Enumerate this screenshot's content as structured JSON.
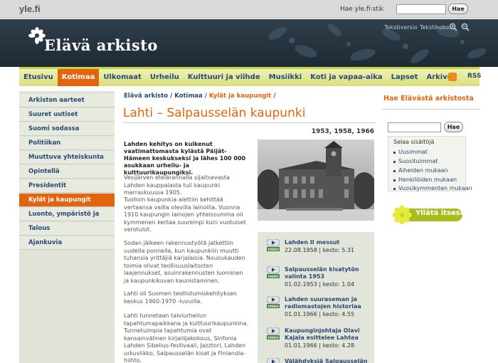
{
  "topbar": {
    "logo": "yle.fi",
    "search_label": "Hae yle.fi:stä:",
    "search_value": "",
    "search_button": "Hae"
  },
  "banner": {
    "site_title": "Elävä arkisto",
    "text_version": "Tekstiversio",
    "text_size": "Tekstikoko:"
  },
  "nav": {
    "items": [
      "Etusivu",
      "Kotimaa",
      "Ulkomaat",
      "Urheilu",
      "Kulttuuri ja viihde",
      "Musiikki",
      "Koti ja vapaa-aika",
      "Lapset",
      "Arkivet"
    ],
    "active": "Kotimaa",
    "rss": "RSS"
  },
  "sidebar": {
    "items": [
      "Arkiston aarteet",
      "Suuret uutiset",
      "Suomi sodassa",
      "Politiikan vuosikymmenet",
      "Muuttuva yhteiskunta",
      "Opintellä",
      "Presidentit",
      "Kylät ja kaupungit",
      "Luonto, ympäristö ja eläimet",
      "Talous",
      "Ajankuvia"
    ],
    "active": "Kylät ja kaupungit"
  },
  "breadcrumb": {
    "parts": [
      "Elävä arkisto",
      "Kotimaa"
    ],
    "current": "Kylät ja kaupungit"
  },
  "article": {
    "title": "Lahti – Salpausselän kaupunki",
    "years": "1953, 1958, 1966",
    "lead": "Lahden kehitys on kulkenut vaatimattomasta kylästä Päijät-Hämeen keskukseksi ja lähes 100 000 asukkaan urheilu- ja kulttuurikaupungiksi.",
    "paragraphs": [
      "Vesijärven etelärannalla sijaitsevasta Lahden kauppalasta tuli kaupunki marraskuussa 1905.",
      "Tuolloin kaupunkia alettiin kehittää vertaansa vailla olevilla lainoilla. Vuonna 1910 kaupungin lainojen yhteissumma oli kymmenen kertaa suurempi kuin vuotuiset verotulot.",
      "Sodan jälkeen rakennustyötä jatkettiin uudella ponnella, kun kaupunkiin muutti tuhansia yrittäjiä karjalaisia. Nousukauden toimia olivat teollisuuslaitosten laajennukset, asuinrakennusten luominen ja kaupunkikuvan kaunistaminen.",
      "Lahti oli Suomen teollistumiskehityksen keskus 1960-1970 -luvuilla.",
      "Lahti tunnetaan talviurheilun tapahtumapaikkana ja kulttuurikaupunkina. Tunnetuimpia tapahtumia ovat kansainvälinen kirjailijakokous, Sinfonia Lahden Sibelius-festivaali, Jazztori, Lahden urkuviikko, Salpausselän kisat ja Finlandia-hiihto."
    ]
  },
  "clips": [
    {
      "title": "Lahden II messut",
      "meta": "22.08.1958 | kesto: 5.31",
      "badge": "VIDEO"
    },
    {
      "title": "Salpausselän kisatytön valinta 1953",
      "meta": "01.02.1953 | kesto: 1.04",
      "badge": "VIDEO"
    },
    {
      "title": "Lahden suuraseman ja radiomastojen historiaa",
      "meta": "01.01.1966 | kesto: 4.55",
      "badge": "VIDEO"
    },
    {
      "title": "Kaupunginjohtaja Olavi Kajala esittelee Lahtea",
      "meta": "01.01.1966 | kesto: 4.28",
      "badge": "VIDEO"
    },
    {
      "title": "Välähdyksiä Salpausselän",
      "meta": "",
      "badge": "VIDEO"
    }
  ],
  "right": {
    "title": "Hae Elävästä arkistosta",
    "search_button": "Hae",
    "browse_label": "Selaa sisältöjä",
    "browse_items": [
      "Uusimmat",
      "Suosituimmat",
      "Aiheiden mukaan",
      "Henkilöiden mukaan",
      "Vuosikymmenten mukaan"
    ],
    "surprise": "Yllätä itsesi"
  },
  "colors": {
    "accent": "#e3640c",
    "link": "#2b4a73",
    "banner": "#2f3f4c",
    "nav": "#d9df7a"
  }
}
